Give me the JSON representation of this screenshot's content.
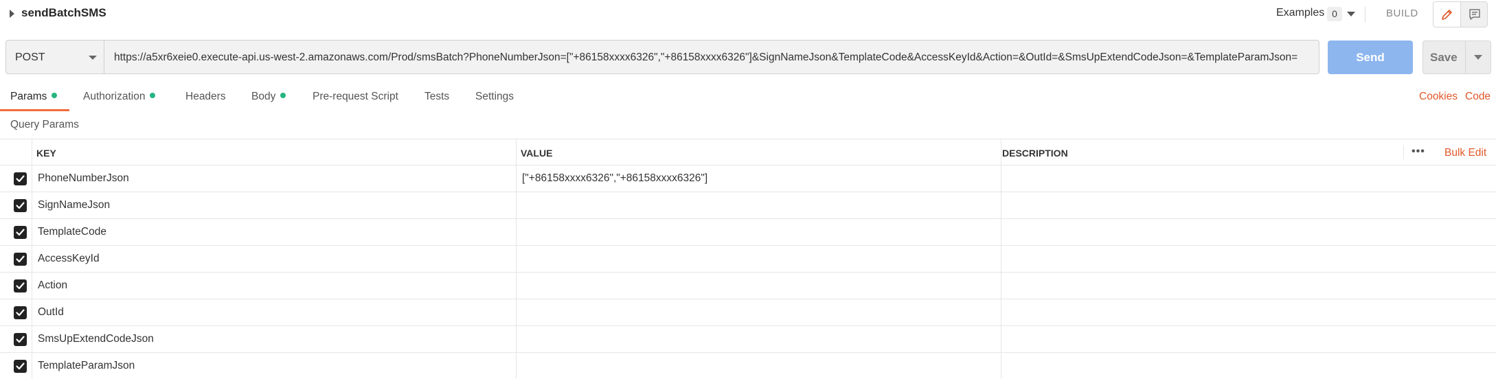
{
  "header": {
    "request_name": "sendBatchSMS",
    "examples_label": "Examples",
    "examples_count": "0",
    "build_label": "BUILD",
    "icons": {
      "edit": "pencil-icon",
      "docs": "comment-icon",
      "collapse": "caret-right-icon"
    }
  },
  "request": {
    "method": "POST",
    "url": "https://a5xr6xeie0.execute-api.us-west-2.amazonaws.com/Prod/smsBatch?PhoneNumberJson=[\"+86158xxxx6326\",\"+86158xxxx6326\"]&SignNameJson&TemplateCode&AccessKeyId&Action=&OutId=&SmsUpExtendCodeJson=&TemplateParamJson=",
    "send_label": "Send",
    "save_label": "Save"
  },
  "tabs": [
    {
      "label": "Params",
      "active": true,
      "dot": true
    },
    {
      "label": "Authorization",
      "active": false,
      "dot": true
    },
    {
      "label": "Headers",
      "active": false,
      "dot": false
    },
    {
      "label": "Body",
      "active": false,
      "dot": true
    },
    {
      "label": "Pre-request Script",
      "active": false,
      "dot": false
    },
    {
      "label": "Tests",
      "active": false,
      "dot": false
    },
    {
      "label": "Settings",
      "active": false,
      "dot": false
    }
  ],
  "links": {
    "cookies": "Cookies",
    "code": "Code"
  },
  "query_params": {
    "title": "Query Params",
    "columns": {
      "key": "KEY",
      "value": "VALUE",
      "description": "DESCRIPTION"
    },
    "bulk_edit": "Bulk Edit",
    "more": "•••",
    "rows": [
      {
        "key": "PhoneNumberJson",
        "value": "[\"+86158xxxx6326\",\"+86158xxxx6326\"]",
        "checked": true
      },
      {
        "key": "SignNameJson",
        "value": "",
        "checked": true
      },
      {
        "key": "TemplateCode",
        "value": "",
        "checked": true
      },
      {
        "key": "AccessKeyId",
        "value": "",
        "checked": true
      },
      {
        "key": "Action",
        "value": "",
        "checked": true
      },
      {
        "key": "OutId",
        "value": "",
        "checked": true
      },
      {
        "key": "SmsUpExtendCodeJson",
        "value": "",
        "checked": true
      },
      {
        "key": "TemplateParamJson",
        "value": "",
        "checked": true
      }
    ]
  },
  "colors": {
    "accent": "#f26b3a",
    "link": "#e0592a",
    "send": "#8db6ef",
    "dot": "#26b47f"
  }
}
